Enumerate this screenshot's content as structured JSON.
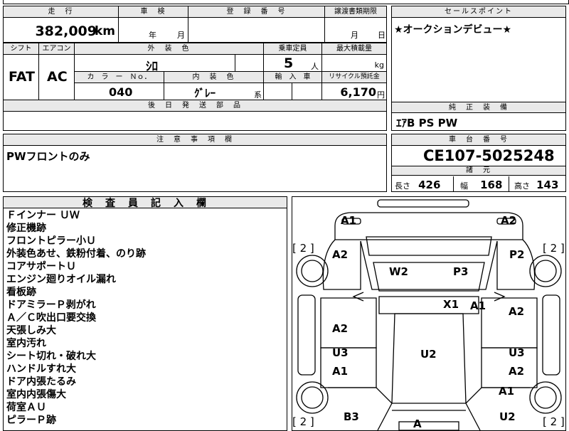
{
  "top": {
    "mileage_header": "走　行",
    "inspection_header": "車　検",
    "registration_header": "登　録　番　号",
    "transfer_header": "譲渡書類期限",
    "sales_header": "セールスポイント",
    "mileage_value": "382,009",
    "mileage_unit": "km",
    "inspection_year": "年",
    "inspection_month": "月",
    "transfer_month": "月",
    "transfer_day": "日",
    "sales_point": "★オークションデビュー★"
  },
  "specs": {
    "shift_header": "シフト",
    "aircon_header": "エアコン",
    "exterior_header": "外　装　色",
    "capacity_header": "乗車定員",
    "max_load_header": "最大積載量",
    "shift_value": "FAT",
    "aircon_value": "AC",
    "exterior_value": "ｼﾛ",
    "capacity_value": "5",
    "capacity_unit": "人",
    "load_unit": "kg",
    "color_no_header": "カ　ラ　ー　Ｎｏ．",
    "interior_header": "内　装　色",
    "import_header": "輸　入　車",
    "recycle_header": "リサイクル預託金",
    "color_no_value": "040",
    "interior_value": "ｸﾞﾚｰ",
    "interior_suffix": "系",
    "recycle_value": "6,170",
    "recycle_unit": "円",
    "later_parts_header": "後　日　発　送　部　品"
  },
  "equipment": {
    "header": "純　正　装　備",
    "value": "ｴｱB PS PW"
  },
  "notes": {
    "header": "注　意　事　項　欄",
    "value": "PWフロントのみ"
  },
  "chassis": {
    "header": "車　台　番　号",
    "value": "CE107-5025248",
    "dims_header": "諸　元",
    "length_label": "長さ",
    "length_value": "426",
    "width_label": "幅",
    "width_value": "168",
    "height_label": "高さ",
    "height_value": "143"
  },
  "inspector": {
    "header": "検　査　員　記　入　欄",
    "lines": [
      "Ｆインナー ＵＷ",
      "修正機跡",
      "フロントピラー小Ｕ",
      "外装色あせ、鉄粉付着、のり跡",
      "コアサポートＵ",
      "エンジン廻りオイル漏れ",
      "看板跡",
      "ドアミラーＰ剥がれ",
      "Ａ／Ｃ吹出口要交換",
      "天張しみ大",
      "室内汚れ",
      "シート切れ・破れ大",
      "ハンドルすれ大",
      "ドア内張たるみ",
      "室内内張傷大",
      "荷室ＡＵ",
      "ピラーＰ跡"
    ]
  },
  "diagram": {
    "labels": {
      "front_left": "A1",
      "front_right": "A2",
      "fender_left": "A2",
      "fender_right": "P2",
      "windshield": "W2",
      "hood": "P3",
      "roof_mark": "X1",
      "roof_right": "A1",
      "door_left_1": "A2",
      "door_right_1": "A2",
      "door_left_2": "U3",
      "door_right_2": "U3",
      "door_left_3": "A1",
      "door_right_3": "A2",
      "roof_center": "U2",
      "quarter_right": "A1",
      "rear_left": "B3",
      "rear_center": "A",
      "rear_right": "U2",
      "tire_fl": "[ 2 ]",
      "tire_fr": "[ 2 ]",
      "tire_rl": "[ 2 ]",
      "tire_rr": "[ 2 ]"
    }
  }
}
